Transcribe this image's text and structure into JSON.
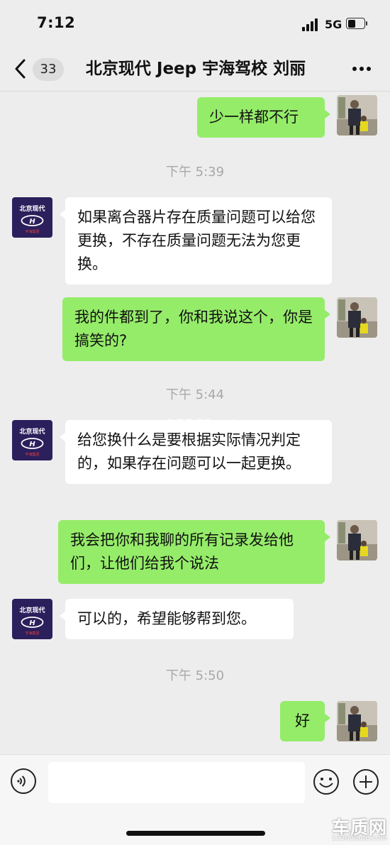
{
  "status_bar": {
    "time": "7:12",
    "network": "5G"
  },
  "nav": {
    "unread_count": "33",
    "title": "北京现代 Jeep 宇海驾校 刘丽"
  },
  "messages": [
    {
      "type": "sent",
      "text": "少一样都不行"
    },
    {
      "type": "timestamp",
      "text": "下午 5:39"
    },
    {
      "type": "received",
      "text": "如果离合器片存在质量问题可以给您更换，不存在质量问题无法为您更换。"
    },
    {
      "type": "sent",
      "text": "我的件都到了，你和我说这个，你是搞笑的?"
    },
    {
      "type": "timestamp",
      "text": "下午 5:44"
    },
    {
      "type": "received",
      "text": "给您换什么是要根据实际情况判定的，如果存在问题可以一起更换。"
    },
    {
      "type": "sent",
      "text": "我会把你和我聊的所有记录发给他们，让他们给我个说法"
    },
    {
      "type": "received",
      "text": "可以的，希望能够帮到您。"
    },
    {
      "type": "timestamp",
      "text": "下午 5:50"
    },
    {
      "type": "sent",
      "text": "好"
    }
  ],
  "contact_avatar": {
    "brand_text": "北京现代",
    "sub_text": "宇海集团",
    "bg_color": "#2b1f5c"
  },
  "watermark": {
    "text": "www.12365auto.com"
  },
  "site_logo": {
    "name": "车质网",
    "url": "12365auto.com"
  },
  "colors": {
    "sent_bubble": "#95ec69",
    "received_bubble": "#ffffff",
    "background": "#ededed"
  },
  "icons": {
    "back": "chevron-left-icon",
    "more": "more-dots-icon",
    "voice": "voice-icon",
    "emoji": "emoji-icon",
    "plus": "plus-icon"
  }
}
